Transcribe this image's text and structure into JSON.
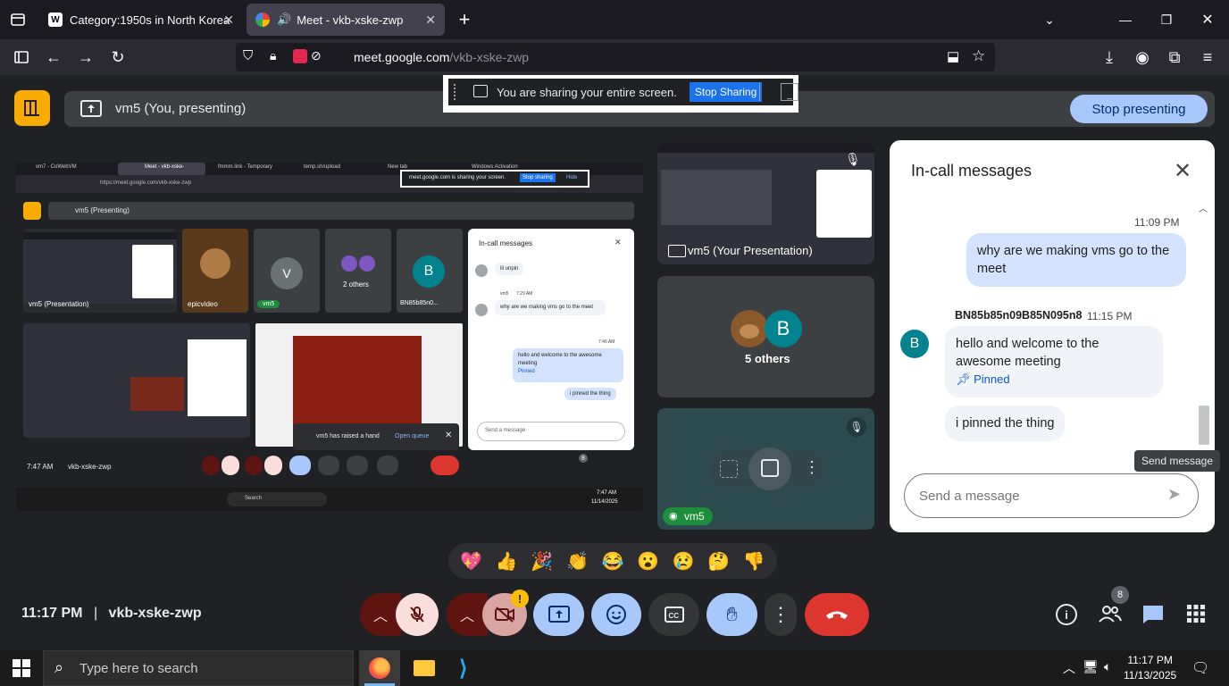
{
  "browser": {
    "tabs": [
      {
        "title": "Category:1950s in North Korea",
        "favicon": "W"
      },
      {
        "title": "Meet - vkb-xske-zwp",
        "active": true
      }
    ],
    "url_domain": "meet.google.com",
    "url_path": "/vkb-xske-zwp"
  },
  "presenting": {
    "label": "vm5 (You, presenting)",
    "stop_button": "Stop presenting"
  },
  "share_popup": {
    "text": "You are sharing your entire screen.",
    "stop_button": "Stop Sharing"
  },
  "shared_screen": {
    "inner_time": "7:47 AM",
    "inner_code": "vkb-xske-zwp",
    "inner_presenting": "vm5 (Presenting)",
    "inner_url": "https://meet.google.com/vkb-xske-zwp",
    "inner_tabs": [
      "vm7 - CoWebVM",
      "Meet - vkb-xske-",
      "fmmm.link - Temporary",
      "temp.sh/upload",
      "New tab",
      "Windows Activation"
    ],
    "inner_share_text": "meet.google.com is sharing your screen.",
    "inner_stop": "Stop sharing",
    "inner_hide": "Hide",
    "inner_tiles": [
      {
        "label": "vm5 (Presentation)"
      },
      {
        "label": "epicvideo"
      },
      {
        "label": "vm5",
        "initial": "V"
      },
      {
        "label": "2 others"
      },
      {
        "label": "BN85b85n0...",
        "initial": "B"
      }
    ],
    "inner_chat": {
      "title": "In-call messages",
      "messages": [
        {
          "text": "lil unpin"
        },
        {
          "sender": "vm5",
          "time": "7:29 AM",
          "text": "why are we making vms go to the meet"
        },
        {
          "time": "7:46 AM",
          "text": "hello and welcome to the awesome meeting",
          "note": "Pinned"
        },
        {
          "text": "i pinned the thing"
        }
      ],
      "input_placeholder": "Send a message"
    },
    "raised_hand": "vm5 has raised a hand",
    "open_queue": "Open queue",
    "inner_search": "Search",
    "inner_clock_time": "7:47 AM",
    "inner_clock_date": "11/14/2025",
    "inner_people_count": "8"
  },
  "side_tiles": {
    "presentation_label": "vm5 (Your Presentation)",
    "others_label": "5 others",
    "others_initial": "B",
    "self_label": "vm5"
  },
  "chat": {
    "title": "In-call messages",
    "messages": [
      {
        "time": "11:09 PM",
        "text": "why are we making vms go to the meet",
        "own": true
      },
      {
        "sender": "BN85b85n09B85N095n8",
        "time": "11:15 PM",
        "avatar": "B",
        "text": "hello and welcome to the awesome meeting",
        "pinned": "Pinned"
      },
      {
        "text": "i pinned the thing"
      }
    ],
    "input_placeholder": "Send a message",
    "send_tooltip": "Send message"
  },
  "reactions": [
    "💖",
    "👍",
    "🎉",
    "👏",
    "😂",
    "😮",
    "😢",
    "🤔",
    "👎"
  ],
  "meeting": {
    "time": "11:17 PM",
    "code": "vkb-xske-zwp",
    "participants": "8"
  },
  "taskbar": {
    "search_placeholder": "Type here to search",
    "time": "11:17 PM",
    "date": "11/13/2025"
  },
  "colors": {
    "accent_blue": "#a8c7fa",
    "hangup_red": "#dc362e",
    "mic_off_bg": "#f9dedc",
    "mute_dark_red": "#601410",
    "present_yellow": "#f9ab00",
    "chat_blue": "#d3e3fd"
  }
}
